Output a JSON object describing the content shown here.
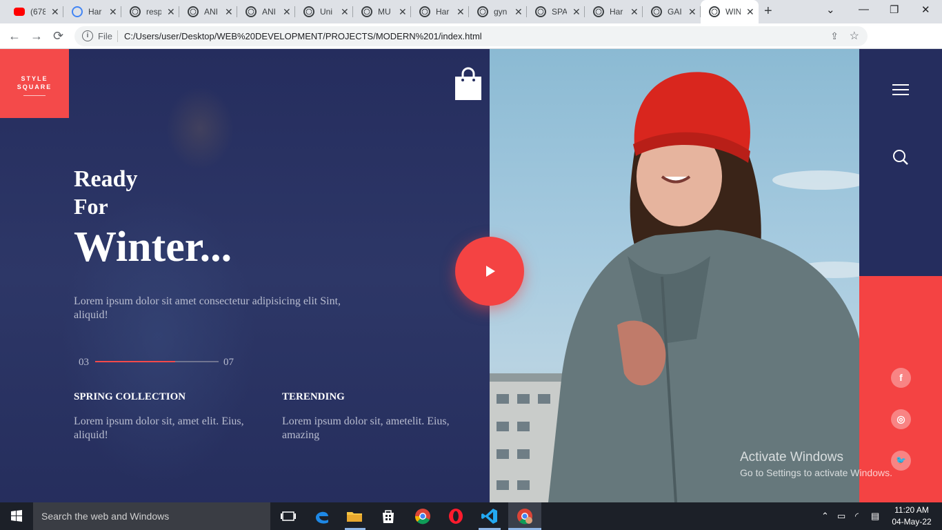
{
  "browser": {
    "tabs": [
      {
        "label": "(678",
        "icon": "youtube-icon",
        "color": "#ff0000"
      },
      {
        "label": "Har",
        "icon": "bot-icon",
        "color": "#4285f4"
      },
      {
        "label": "resp",
        "icon": "globe-icon",
        "color": "#3c4043"
      },
      {
        "label": "ANI",
        "icon": "globe-icon",
        "color": "#3c4043"
      },
      {
        "label": "ANI",
        "icon": "globe-icon",
        "color": "#3c4043"
      },
      {
        "label": "Uni",
        "icon": "globe-icon",
        "color": "#3c4043"
      },
      {
        "label": "MU",
        "icon": "globe-icon",
        "color": "#3c4043"
      },
      {
        "label": "Har",
        "icon": "globe-icon",
        "color": "#3c4043"
      },
      {
        "label": "gyn",
        "icon": "globe-icon",
        "color": "#3c4043"
      },
      {
        "label": "SPA",
        "icon": "globe-icon",
        "color": "#3c4043"
      },
      {
        "label": "Har",
        "icon": "globe-icon",
        "color": "#3c4043"
      },
      {
        "label": "GAI",
        "icon": "globe-icon",
        "color": "#3c4043"
      },
      {
        "label": "WIN",
        "icon": "globe-icon",
        "color": "#3c4043"
      }
    ],
    "active_tab": 12,
    "file_label": "File",
    "url": "C:/Users/user/Desktop/WEB%20DEVELOPMENT/PROJECTS/MODERN%201/index.html"
  },
  "site": {
    "logo_line1": "STYLE",
    "logo_line2": "SQUARE",
    "heading_ready": "Ready",
    "heading_for": "For",
    "heading_winter": "Winter...",
    "description": "Lorem ipsum dolor sit amet consectetur adipisicing elit Sint, aliquid!",
    "slide_current": "03",
    "slide_total": "07",
    "slide_progress": 0.65,
    "columns": [
      {
        "title": "SPRING COLLECTION",
        "text": "Lorem ipsum dolor sit, amet elit. Eius, aliquid!"
      },
      {
        "title": "TERENDING",
        "text": "Lorem ipsum dolor sit, ametelit. Eius, amazing"
      }
    ],
    "social": [
      {
        "icon": "facebook-icon",
        "glyph": "f"
      },
      {
        "icon": "instagram-icon",
        "glyph": "◎"
      },
      {
        "icon": "twitter-icon",
        "glyph": "🐦"
      }
    ],
    "colors": {
      "navy": "#252d5e",
      "accent": "#f44343"
    }
  },
  "watermark": {
    "line1": "Activate Windows",
    "line2": "Go to Settings to activate Windows."
  },
  "taskbar": {
    "search_placeholder": "Search the web and Windows",
    "time": "11:20 AM",
    "date": "04-May-22"
  }
}
